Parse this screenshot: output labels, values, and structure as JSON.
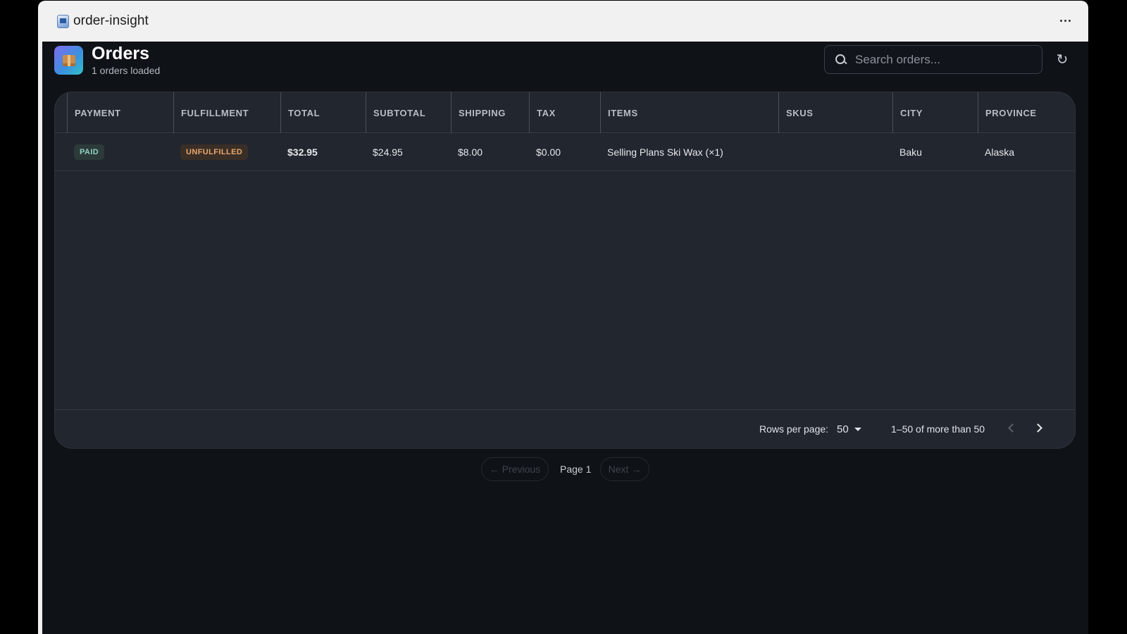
{
  "window": {
    "title": "order-insight"
  },
  "header": {
    "title": "Orders",
    "subtitle": "1 orders loaded",
    "search_placeholder": "Search orders..."
  },
  "table": {
    "columns": [
      "PAYMENT",
      "FULFILLMENT",
      "TOTAL",
      "SUBTOTAL",
      "SHIPPING",
      "TAX",
      "ITEMS",
      "SKUS",
      "CITY",
      "PROVINCE"
    ],
    "rows": [
      {
        "payment": "PAID",
        "fulfillment": "UNFULFILLED",
        "total": "$32.95",
        "subtotal": "$24.95",
        "shipping": "$8.00",
        "tax": "$0.00",
        "items": "Selling Plans Ski Wax (×1)",
        "skus": "",
        "city": "Baku",
        "province": "Alaska"
      }
    ]
  },
  "footer": {
    "rows_per_page_label": "Rows per page:",
    "rows_per_page_value": "50",
    "range_text": "1–50 of more than 50"
  },
  "pager": {
    "previous_label": "← Previous",
    "page_label": "Page 1",
    "next_label": "Next →"
  },
  "colors": {
    "background": "#0f1217",
    "card": "#22262e",
    "paid_badge": "#8fd1c2",
    "unfulfilled_badge": "#e9a66d"
  },
  "icons": {
    "app": "app-icon",
    "more": "more-options-icon",
    "logo": "package-box-icon",
    "search": "search-icon",
    "refresh": "refresh-icon",
    "dropdown": "caret-down-icon",
    "prev": "chevron-left-icon",
    "next": "chevron-right-icon"
  }
}
